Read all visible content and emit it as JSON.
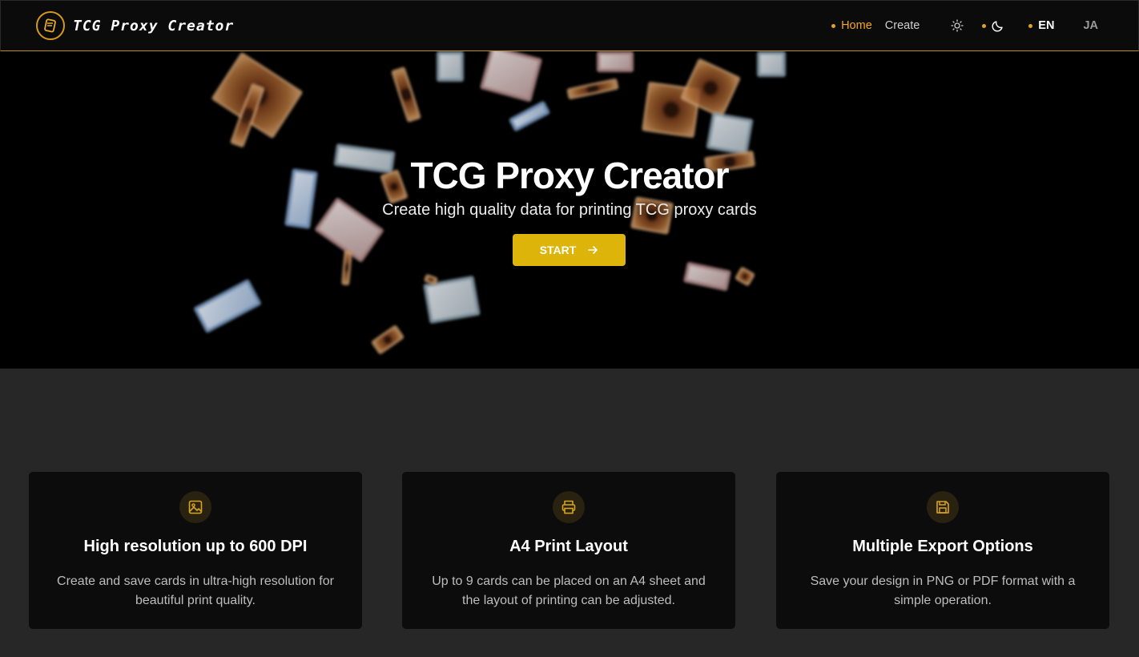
{
  "nav": {
    "brand": "TCG Proxy Creator",
    "home": "Home",
    "create": "Create",
    "lang_en": "EN",
    "lang_ja": "JA"
  },
  "hero": {
    "title": "TCG Proxy Creator",
    "subtitle": "Create high quality data for printing TCG proxy cards",
    "start_label": "START"
  },
  "features": [
    {
      "title": "High resolution up to 600 DPI",
      "text": "Create and save cards in ultra-high resolution for beautiful print quality.",
      "icon": "image-icon"
    },
    {
      "title": "A4 Print Layout",
      "text": "Up to 9 cards can be placed on an A4 sheet and the layout of printing can be adjusted.",
      "icon": "printer-icon"
    },
    {
      "title": "Multiple Export Options",
      "text": "Save your design in PNG or PDF format with a simple operation.",
      "icon": "save-icon"
    }
  ],
  "colors": {
    "accent": "#f5a623",
    "button": "#dcb40a",
    "hero_bg": "#000000",
    "page_bg": "#272727",
    "card_bg": "#0c0c0c"
  }
}
